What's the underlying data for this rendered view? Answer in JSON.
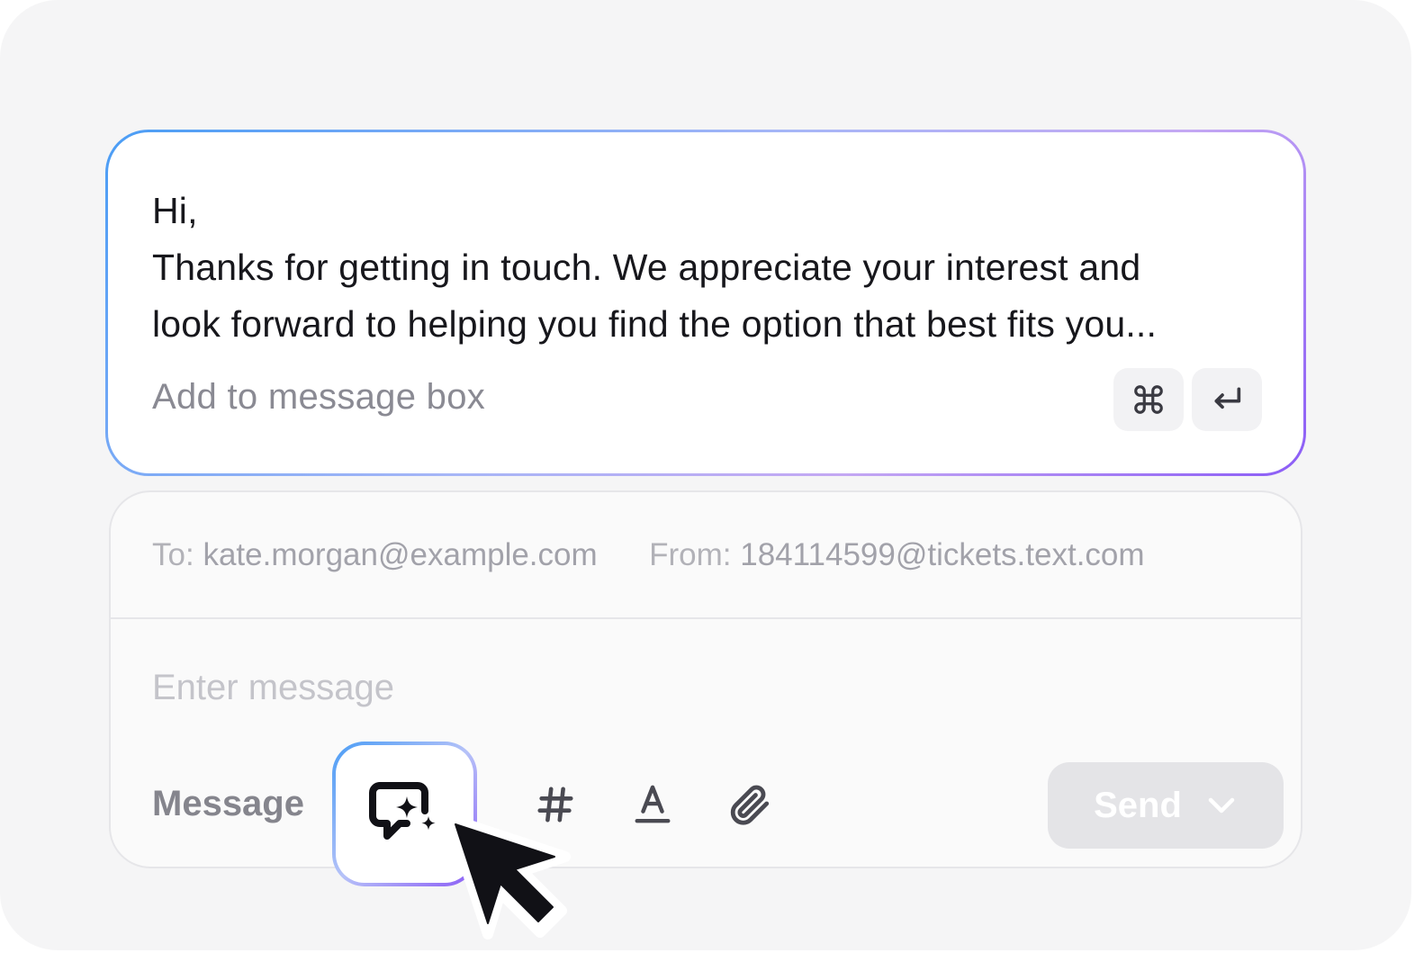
{
  "suggestion": {
    "lines": [
      "Hi,",
      "Thanks for getting in touch. We appreciate your interest and",
      "look forward to helping you find the option that best fits you..."
    ],
    "hint": "Add to message box",
    "shortcut_icons": [
      "command-key-icon",
      "enter-key-icon"
    ]
  },
  "composer": {
    "to_label": "To:",
    "to_value": "kate.morgan@example.com",
    "from_label": "From:",
    "from_value": "184114599@tickets.text.com",
    "message_placeholder": "Enter message",
    "tab_label": "Message",
    "tools": [
      "ai-compose-icon",
      "hashtag-icon",
      "text-format-icon",
      "paperclip-icon"
    ],
    "send_label": "Send"
  },
  "colors": {
    "gradient_start": "#4a9df5",
    "gradient_end": "#8b5cf6",
    "background": "#f5f5f6",
    "send_disabled": "#e4e4e7"
  }
}
